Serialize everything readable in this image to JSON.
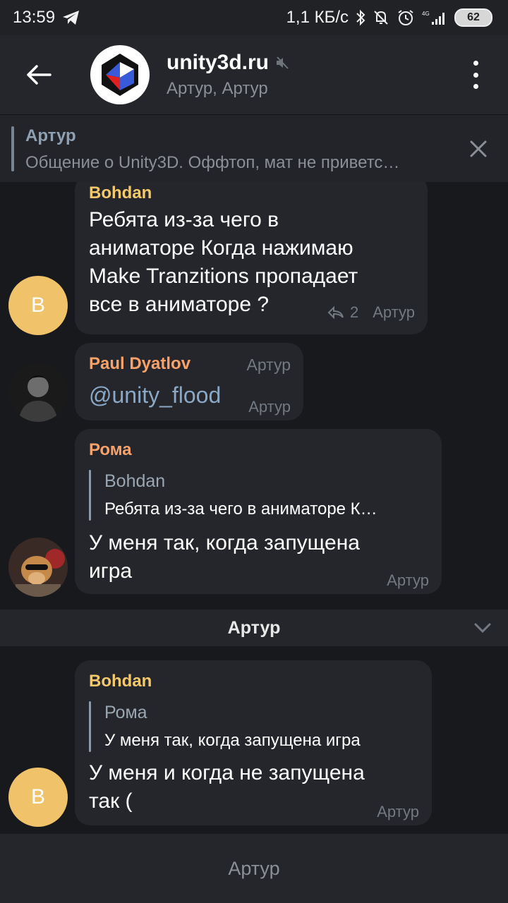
{
  "status_bar": {
    "time": "13:59",
    "network_speed": "1,1 КБ/с",
    "signal": "4G",
    "battery": "62"
  },
  "header": {
    "title": "unity3d.ru",
    "subtitle": "Артур, Артур"
  },
  "pinned": {
    "title": "Артур",
    "text": "Общение о Unity3D. Оффтоп, мат не приветс…"
  },
  "messages": [
    {
      "sender": "Bohdan",
      "sender_color": "#f4c96b",
      "avatar_letter": "B",
      "lines": [
        "Ребята из-за чего в",
        "аниматоре Когда нажимаю",
        "Make Tranzitions пропадает",
        "все в аниматоре ?"
      ],
      "reply_count": "2",
      "signature": "Артур"
    },
    {
      "sender": "Paul Dyatlov",
      "sender_color": "#f7a26a",
      "header_signature": "Артур",
      "text": "@unity_flood",
      "signature": "Артур"
    },
    {
      "sender": "Рома",
      "sender_color": "#f7a26a",
      "quote": {
        "name": "Bohdan",
        "text": "Ребята из-за чего в аниматоре К…"
      },
      "lines": [
        "У меня так, когда запущена",
        "игра"
      ],
      "signature": "Артур"
    },
    {
      "sender": "Bohdan",
      "sender_color": "#f4c96b",
      "avatar_letter": "B",
      "quote": {
        "name": "Рома",
        "text": "У меня так, когда запущена игра"
      },
      "lines": [
        "У меня и когда не запущена",
        "так ("
      ],
      "signature": "Артур"
    }
  ],
  "date_separator": "Артур",
  "bottom_bar": "Артур",
  "colors": {
    "background": "#18191d",
    "bubble": "#24262b",
    "link": "#8aa8c6",
    "avatar_b": "#f0c26a"
  }
}
